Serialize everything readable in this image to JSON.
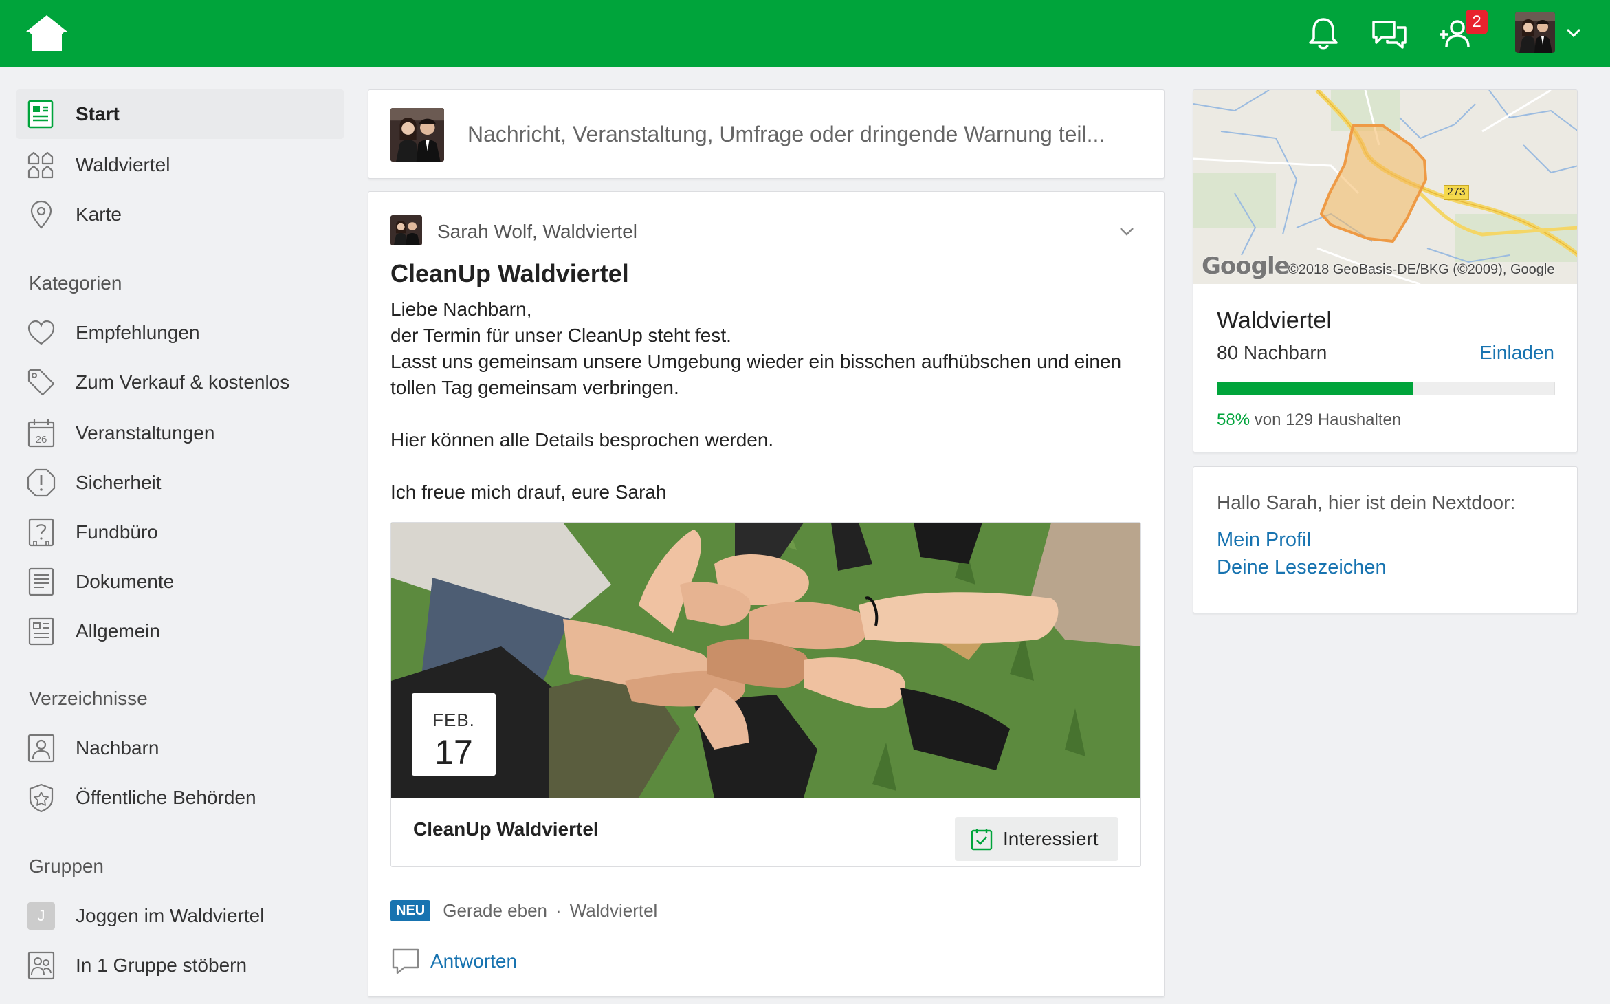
{
  "header": {
    "notifications_badge": "2",
    "brand_color": "#00a43b"
  },
  "composer": {
    "placeholder": "Nachricht, Veranstaltung, Umfrage oder dringende Warnung teil..."
  },
  "sidebar": {
    "main_items": [
      {
        "label": "Start",
        "icon": "news-feed-icon",
        "active": true
      },
      {
        "label": "Waldviertel",
        "icon": "neighborhood-icon"
      },
      {
        "label": "Karte",
        "icon": "map-pin-icon"
      }
    ],
    "categories_heading": "Kategorien",
    "categories": [
      {
        "label": "Empfehlungen",
        "icon": "heart-icon"
      },
      {
        "label": "Zum Verkauf & kostenlos",
        "icon": "tag-icon"
      },
      {
        "label": "Veranstaltungen",
        "icon": "calendar-icon",
        "icon_text": "26"
      },
      {
        "label": "Sicherheit",
        "icon": "alert-icon"
      },
      {
        "label": "Fundbüro",
        "icon": "lost-found-icon"
      },
      {
        "label": "Dokumente",
        "icon": "document-icon"
      },
      {
        "label": "Allgemein",
        "icon": "general-icon"
      }
    ],
    "directories_heading": "Verzeichnisse",
    "directories": [
      {
        "label": "Nachbarn",
        "icon": "person-icon"
      },
      {
        "label": "Öffentliche Behörden",
        "icon": "badge-icon"
      }
    ],
    "groups_heading": "Gruppen",
    "groups": [
      {
        "label": "Joggen im Waldviertel",
        "initial": "J"
      },
      {
        "label": "In 1 Gruppe stöbern",
        "icon": "groups-icon"
      }
    ]
  },
  "post": {
    "author": "Sarah Wolf, Waldviertel",
    "title": "CleanUp Waldviertel",
    "body": "Liebe Nachbarn,\nder Termin für unser CleanUp steht fest.\nLasst uns gemeinsam unsere Umgebung wieder ein bisschen aufhübschen und einen tollen Tag gemeinsam verbringen.\n\nHier können alle Details besprochen werden.\n\nIch freue mich drauf, eure Sarah",
    "event": {
      "month": "FEB.",
      "day": "17",
      "title": "CleanUp Waldviertel",
      "interest_label": "Interessiert"
    },
    "badge": "NEU",
    "time": "Gerade eben",
    "separator": "·",
    "location": "Waldviertel",
    "reply_label": "Antworten"
  },
  "neighborhood": {
    "map_copyright": "©2018 GeoBasis-DE/BKG (©2009), Google",
    "map_logo": "Google",
    "road_number": "273",
    "name": "Waldviertel",
    "neighbors": "80 Nachbarn",
    "invite_label": "Einladen",
    "progress_fraction": 0.58,
    "progress_percent": "58%",
    "progress_rest": "von 129 Haushalten"
  },
  "hello": {
    "greeting": "Hallo Sarah, hier ist dein Nextdoor:",
    "links": [
      "Mein Profil",
      "Deine Lesezeichen"
    ]
  }
}
